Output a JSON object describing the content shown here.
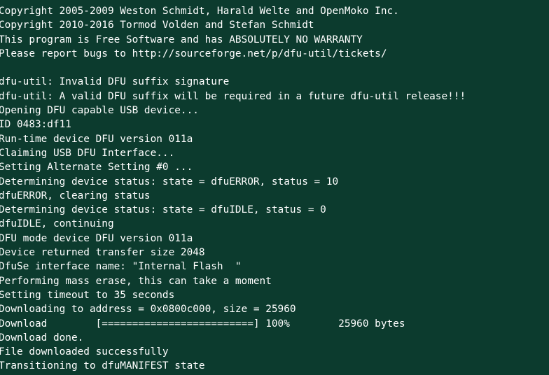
{
  "terminal": {
    "lines": [
      "Copyright 2005-2009 Weston Schmidt, Harald Welte and OpenMoko Inc.",
      "Copyright 2010-2016 Tormod Volden and Stefan Schmidt",
      "This program is Free Software and has ABSOLUTELY NO WARRANTY",
      "Please report bugs to http://sourceforge.net/p/dfu-util/tickets/",
      "",
      "dfu-util: Invalid DFU suffix signature",
      "dfu-util: A valid DFU suffix will be required in a future dfu-util release!!!",
      "Opening DFU capable USB device...",
      "ID 0483:df11",
      "Run-time device DFU version 011a",
      "Claiming USB DFU Interface...",
      "Setting Alternate Setting #0 ...",
      "Determining device status: state = dfuERROR, status = 10",
      "dfuERROR, clearing status",
      "Determining device status: state = dfuIDLE, status = 0",
      "dfuIDLE, continuing",
      "DFU mode device DFU version 011a",
      "Device returned transfer size 2048",
      "DfuSe interface name: \"Internal Flash  \"",
      "Performing mass erase, this can take a moment",
      "Setting timeout to 35 seconds",
      "Downloading to address = 0x0800c000, size = 25960",
      "Download\t[=========================] 100%        25960 bytes",
      "Download done.",
      "File downloaded successfully",
      "Transitioning to dfuMANIFEST state"
    ]
  }
}
